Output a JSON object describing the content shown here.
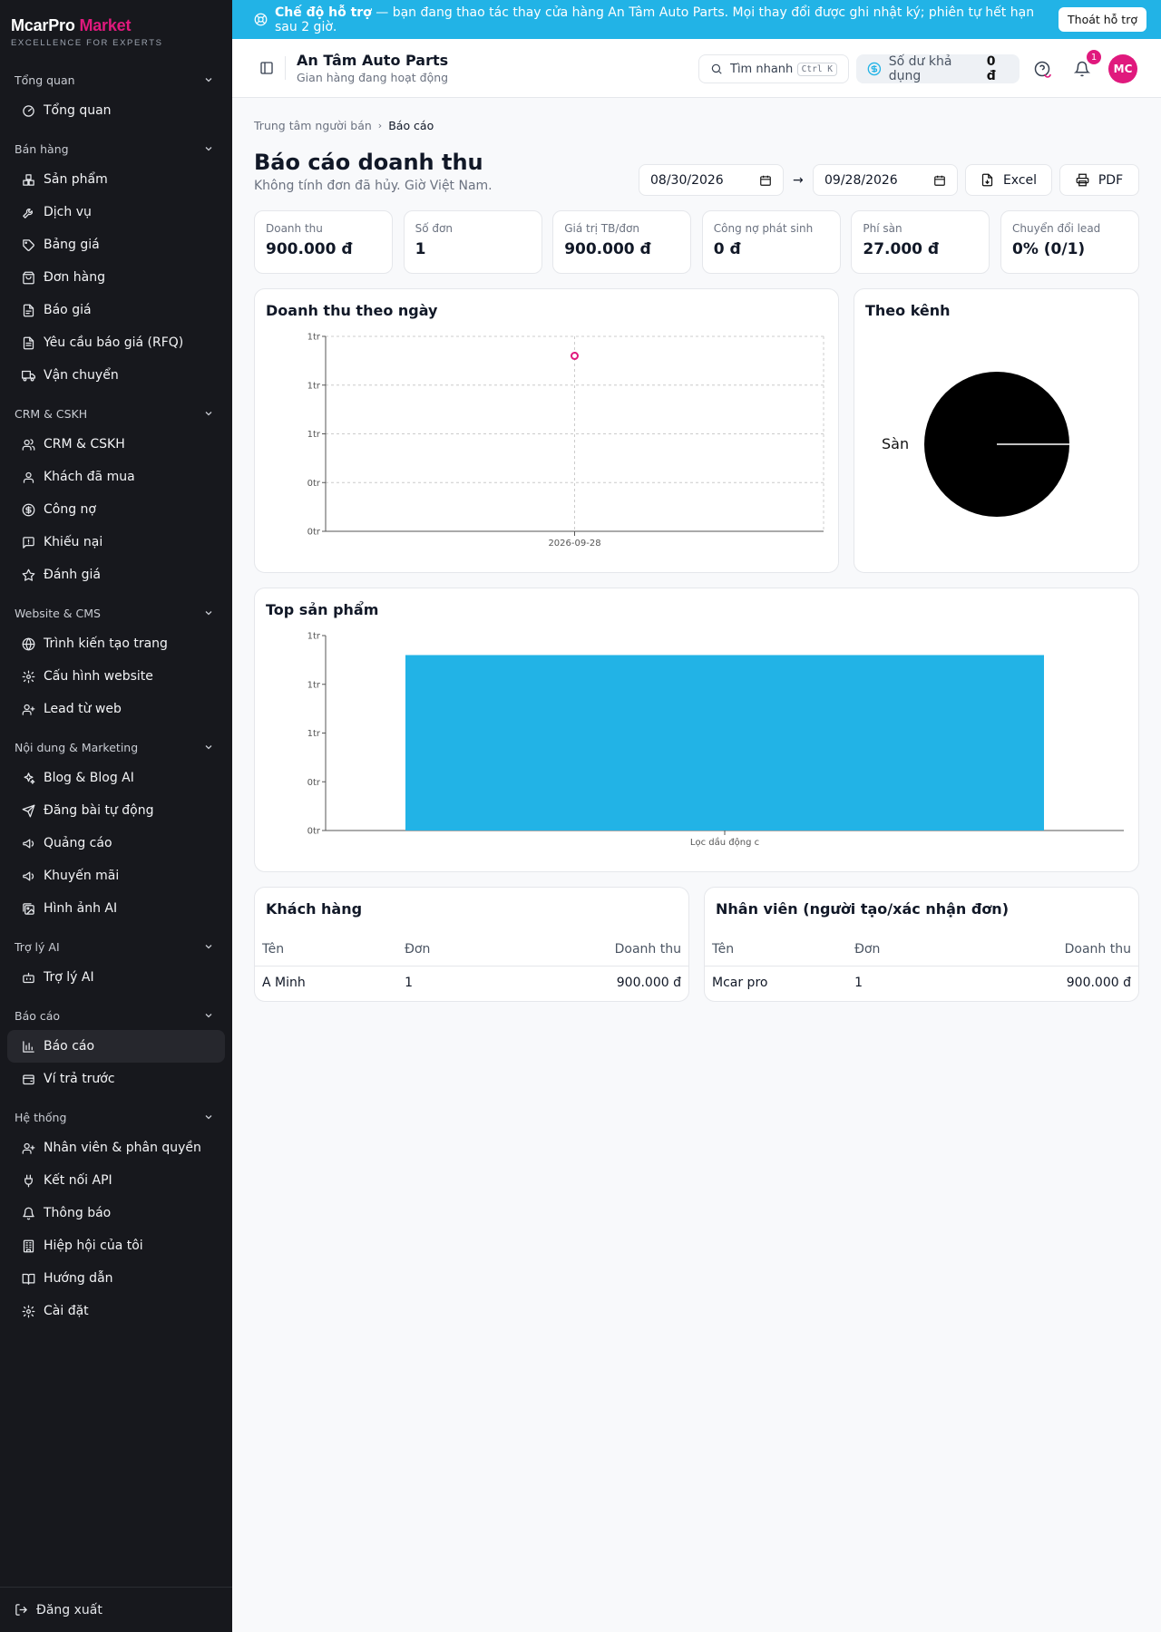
{
  "brand": {
    "name": "McarPro",
    "accent": "Market",
    "tagline": "EXCELLENCE FOR EXPERTS"
  },
  "sidebar": {
    "sections": [
      {
        "title": "Tổng quan",
        "items": [
          {
            "label": "Tổng quan",
            "icon": "overview-icon"
          }
        ]
      },
      {
        "title": "Bán hàng",
        "items": [
          {
            "label": "Sản phẩm",
            "icon": "boxes-icon"
          },
          {
            "label": "Dịch vụ",
            "icon": "wrench-icon"
          },
          {
            "label": "Bảng giá",
            "icon": "tag-icon"
          },
          {
            "label": "Đơn hàng",
            "icon": "shopping-bag-icon"
          },
          {
            "label": "Báo giá",
            "icon": "file-icon"
          },
          {
            "label": "Yêu cầu báo giá (RFQ)",
            "icon": "file-text-icon"
          },
          {
            "label": "Vận chuyển",
            "icon": "truck-icon"
          }
        ]
      },
      {
        "title": "CRM & CSKH",
        "items": [
          {
            "label": "CRM & CSKH",
            "icon": "users-icon"
          },
          {
            "label": "Khách đã mua",
            "icon": "user-icon"
          },
          {
            "label": "Công nợ",
            "icon": "dollar-circle-icon"
          },
          {
            "label": "Khiếu nại",
            "icon": "message-alert-icon"
          },
          {
            "label": "Đánh giá",
            "icon": "star-icon"
          }
        ]
      },
      {
        "title": "Website & CMS",
        "items": [
          {
            "label": "Trình kiến tạo trang",
            "icon": "globe-icon"
          },
          {
            "label": "Cấu hình website",
            "icon": "gear-icon"
          },
          {
            "label": "Lead từ web",
            "icon": "user-plus-icon"
          }
        ]
      },
      {
        "title": "Nội dung & Marketing",
        "items": [
          {
            "label": "Blog & Blog AI",
            "icon": "sparkles-icon"
          },
          {
            "label": "Đăng bài tự động",
            "icon": "send-icon"
          },
          {
            "label": "Quảng cáo",
            "icon": "megaphone-icon"
          },
          {
            "label": "Khuyến mãi",
            "icon": "megaphone-icon"
          },
          {
            "label": "Hình ảnh AI",
            "icon": "images-icon"
          }
        ]
      },
      {
        "title": "Trợ lý AI",
        "items": [
          {
            "label": "Trợ lý AI",
            "icon": "bot-icon"
          }
        ]
      },
      {
        "title": "Báo cáo",
        "items": [
          {
            "label": "Báo cáo",
            "icon": "bar-chart-icon",
            "active": true
          },
          {
            "label": "Ví trả trước",
            "icon": "wallet-icon"
          }
        ]
      },
      {
        "title": "Hệ thống",
        "items": [
          {
            "label": "Nhân viên & phân quyền",
            "icon": "user-plus-icon"
          },
          {
            "label": "Kết nối API",
            "icon": "plug-icon"
          },
          {
            "label": "Thông báo",
            "icon": "bell-icon"
          },
          {
            "label": "Hiệp hội của tôi",
            "icon": "building-icon"
          },
          {
            "label": "Hướng dẫn",
            "icon": "book-icon"
          },
          {
            "label": "Cài đặt",
            "icon": "gear-icon"
          }
        ]
      }
    ],
    "logout": "Đăng xuất"
  },
  "banner": {
    "bold": "Chế độ hỗ trợ",
    "text": " — bạn đang thao tác thay cửa hàng An Tâm Auto Parts. Mọi thay đổi được ghi nhật ký; phiên tự hết hạn sau 2 giờ.",
    "button": "Thoát hỗ trợ"
  },
  "topbar": {
    "store_name": "An Tâm Auto Parts",
    "store_status": "Gian hàng đang hoạt động",
    "search_label": "Tìm nhanh",
    "search_kbd": "Ctrl K",
    "balance_label": "Số dư khả dụng",
    "balance_value": "0 đ",
    "notif_count": "1",
    "avatar": "MC"
  },
  "breadcrumb": {
    "parent": "Trung tâm người bán",
    "current": "Báo cáo"
  },
  "page": {
    "title": "Báo cáo doanh thu",
    "subtitle": "Không tính đơn đã hủy. Giờ Việt Nam."
  },
  "filters": {
    "from": "08/30/2026",
    "arrow": "→",
    "to": "09/28/2026",
    "excel": "Excel",
    "pdf": "PDF"
  },
  "kpis": [
    {
      "label": "Doanh thu",
      "value": "900.000 đ"
    },
    {
      "label": "Số đơn",
      "value": "1"
    },
    {
      "label": "Giá trị TB/đơn",
      "value": "900.000 đ"
    },
    {
      "label": "Công nợ phát sinh",
      "value": "0 đ"
    },
    {
      "label": "Phí sàn",
      "value": "27.000 đ"
    },
    {
      "label": "Chuyển đổi lead",
      "value": "0% (0/1)"
    }
  ],
  "charts_titles": {
    "daily": "Doanh thu theo ngày",
    "channel": "Theo kênh",
    "top": "Top sản phẩm"
  },
  "chart_data": [
    {
      "type": "line",
      "title": "Doanh thu theo ngày",
      "x": [
        "2026-09-28"
      ],
      "y": [
        900000
      ],
      "ylim": [
        0,
        1000000
      ],
      "yticks": [
        "0tr",
        "0tr",
        "1tr",
        "1tr",
        "1tr"
      ],
      "grid": true,
      "color": "#e0197d"
    },
    {
      "type": "pie",
      "title": "Theo kênh",
      "labels": [
        "Sàn"
      ],
      "values": [
        900000
      ],
      "color": "#000000"
    },
    {
      "type": "bar",
      "title": "Top sản phẩm",
      "categories": [
        "Lọc dầu động c"
      ],
      "values": [
        900000
      ],
      "ylim": [
        0,
        1000000
      ],
      "yticks": [
        "0tr",
        "0tr",
        "1tr",
        "1tr",
        "1tr"
      ],
      "color": "#22b3e6"
    }
  ],
  "customers": {
    "title": "Khách hàng",
    "headers": [
      "Tên",
      "Đơn",
      "Doanh thu"
    ],
    "rows": [
      [
        "A Minh",
        "1",
        "900.000 đ"
      ]
    ]
  },
  "staff": {
    "title": "Nhân viên (người tạo/xác nhận đơn)",
    "headers": [
      "Tên",
      "Đơn",
      "Doanh thu"
    ],
    "rows": [
      [
        "Mcar pro",
        "1",
        "900.000 đ"
      ]
    ]
  }
}
